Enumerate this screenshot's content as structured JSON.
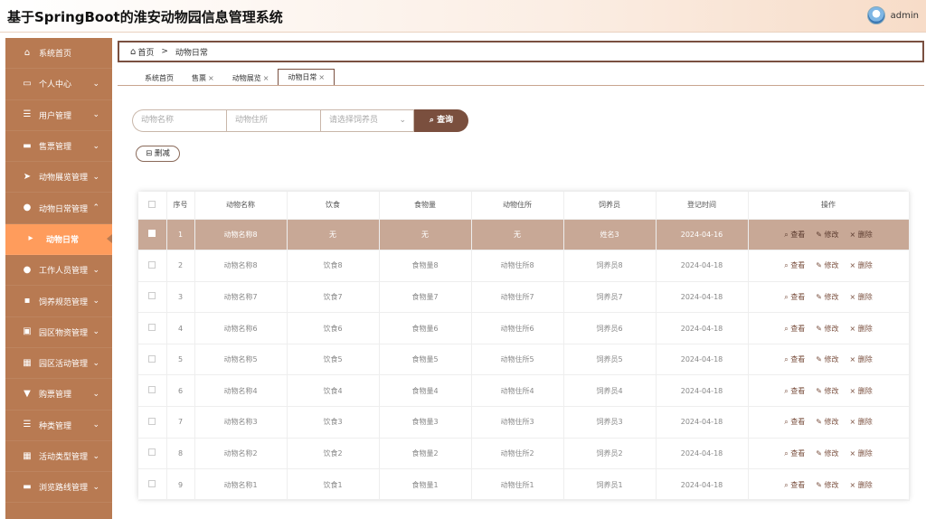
{
  "header": {
    "title": "基于SpringBoot的淮安动物园信息管理系统",
    "username": "admin"
  },
  "sidebar": {
    "items": [
      {
        "label": "系统首页",
        "icon": "home-icon",
        "glyph": "⌂",
        "chevron": ""
      },
      {
        "label": "个人中心",
        "icon": "card-icon",
        "glyph": "▭",
        "chevron": "⌄"
      },
      {
        "label": "用户管理",
        "icon": "list-icon",
        "glyph": "☰",
        "chevron": "⌄"
      },
      {
        "label": "售票管理",
        "icon": "ticket-icon",
        "glyph": "▬",
        "chevron": "⌄"
      },
      {
        "label": "动物展览管理",
        "icon": "send-icon",
        "glyph": "➤",
        "chevron": "⌄"
      },
      {
        "label": "动物日常管理",
        "icon": "user-icon",
        "glyph": "●",
        "chevron": "⌃"
      },
      {
        "label": "动物日常",
        "icon": "caret-right-icon",
        "glyph": "▸",
        "chevron": "",
        "sub": true
      },
      {
        "label": "工作人员管理",
        "icon": "person-icon",
        "glyph": "●",
        "chevron": "⌄"
      },
      {
        "label": "饲养规范管理",
        "icon": "chat-icon",
        "glyph": "▪",
        "chevron": "⌄"
      },
      {
        "label": "园区物资管理",
        "icon": "box-icon",
        "glyph": "▣",
        "chevron": "⌄"
      },
      {
        "label": "园区活动管理",
        "icon": "grid-icon",
        "glyph": "▦",
        "chevron": "⌄"
      },
      {
        "label": "购票管理",
        "icon": "cart-icon",
        "glyph": "▼",
        "chevron": "⌄"
      },
      {
        "label": "种类管理",
        "icon": "list-icon",
        "glyph": "☰",
        "chevron": "⌄"
      },
      {
        "label": "活动类型管理",
        "icon": "grid-icon",
        "glyph": "▦",
        "chevron": "⌄"
      },
      {
        "label": "浏览路线管理",
        "icon": "route-icon",
        "glyph": "▬",
        "chevron": "⌄"
      }
    ]
  },
  "breadcrumb": {
    "home": "首页",
    "sep": ">",
    "current": "动物日常"
  },
  "tabs": [
    {
      "label": "系统首页",
      "closable": false
    },
    {
      "label": "售票",
      "closable": true
    },
    {
      "label": "动物展览",
      "closable": true
    },
    {
      "label": "动物日常",
      "closable": true,
      "active": true
    }
  ],
  "search": {
    "name_placeholder": "动物名称",
    "home_placeholder": "动物住所",
    "keeper_placeholder": "请选择饲养员",
    "button": "查询"
  },
  "actions": {
    "delete": "删减"
  },
  "table": {
    "columns": [
      "",
      "序号",
      "动物名称",
      "饮食",
      "食物量",
      "动物住所",
      "饲养员",
      "登记时间",
      "操作"
    ],
    "rows": [
      [
        "1",
        "动物名称8",
        "无",
        "无",
        "无",
        "姓名3",
        "2024-04-16"
      ],
      [
        "2",
        "动物名称8",
        "饮食8",
        "食物量8",
        "动物住所8",
        "饲养员8",
        "2024-04-18"
      ],
      [
        "3",
        "动物名称7",
        "饮食7",
        "食物量7",
        "动物住所7",
        "饲养员7",
        "2024-04-18"
      ],
      [
        "4",
        "动物名称6",
        "饮食6",
        "食物量6",
        "动物住所6",
        "饲养员6",
        "2024-04-18"
      ],
      [
        "5",
        "动物名称5",
        "饮食5",
        "食物量5",
        "动物住所5",
        "饲养员5",
        "2024-04-18"
      ],
      [
        "6",
        "动物名称4",
        "饮食4",
        "食物量4",
        "动物住所4",
        "饲养员4",
        "2024-04-18"
      ],
      [
        "7",
        "动物名称3",
        "饮食3",
        "食物量3",
        "动物住所3",
        "饲养员3",
        "2024-04-18"
      ],
      [
        "8",
        "动物名称2",
        "饮食2",
        "食物量2",
        "动物住所2",
        "饲养员2",
        "2024-04-18"
      ],
      [
        "9",
        "动物名称1",
        "饮食1",
        "食物量1",
        "动物住所1",
        "饲养员1",
        "2024-04-18"
      ]
    ],
    "ops": {
      "view": "查看",
      "edit": "修改",
      "delete": "删除"
    }
  },
  "colors": {
    "sidebar": "#b87a52",
    "accent": "#ff9c5c",
    "button": "#7a4f3e",
    "highlight_row": "#c8a896"
  }
}
